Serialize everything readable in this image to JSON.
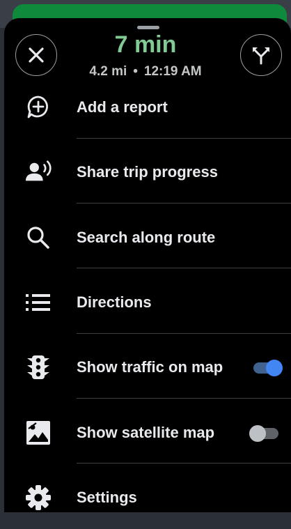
{
  "header": {
    "eta_time": "7 min",
    "distance": "4.2 mi",
    "separator": "•",
    "arrival_time": "12:19 AM",
    "close_icon": "close-icon",
    "routes_icon": "alternate-routes-icon"
  },
  "menu": {
    "items": [
      {
        "label": "Add a report",
        "icon": "add-report-icon"
      },
      {
        "label": "Share trip progress",
        "icon": "share-trip-icon"
      },
      {
        "label": "Search along route",
        "icon": "search-icon"
      },
      {
        "label": "Directions",
        "icon": "directions-list-icon"
      },
      {
        "label": "Show traffic on map",
        "icon": "traffic-light-icon",
        "toggle_on": true
      },
      {
        "label": "Show satellite map",
        "icon": "satellite-image-icon",
        "toggle_on": false
      },
      {
        "label": "Settings",
        "icon": "settings-gear-icon"
      }
    ]
  },
  "colors": {
    "eta_green": "#81c995",
    "banner_green": "#0f8a3c",
    "toggle_on": "#4285f4",
    "sheet_background": "#000000"
  }
}
